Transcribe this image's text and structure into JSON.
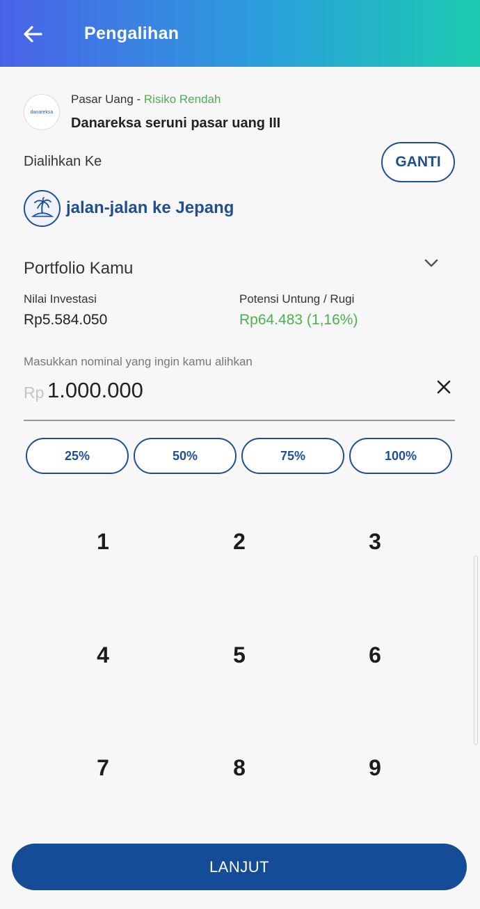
{
  "header": {
    "title": "Pengalihan",
    "back_icon": "arrow-left-icon"
  },
  "source_fund": {
    "logo_text": "danareksa",
    "category": "Pasar Uang",
    "separator": " - ",
    "risk": "Risiko Rendah",
    "risk_color": "#4caf50",
    "name": "Danareksa seruni pasar uang III"
  },
  "transfer_to": {
    "label": "Dialihkan Ke",
    "change_label": "GANTI"
  },
  "goal": {
    "icon": "palm-island-icon",
    "name": "jalan-jalan ke Jepang"
  },
  "portfolio": {
    "title": "Portfolio Kamu",
    "investment_label": "Nilai Investasi",
    "investment_value": "Rp5.584.050",
    "profit_label": "Potensi Untung / Rugi",
    "profit_value": "Rp64.483 (1,16%)",
    "profit_color": "#4caf50"
  },
  "amount": {
    "label": "Masukkan nominal yang ingin kamu alihkan",
    "currency": "Rp",
    "value": "1.000.000"
  },
  "percent_options": [
    "25%",
    "50%",
    "75%",
    "100%"
  ],
  "keypad": [
    "1",
    "2",
    "3",
    "4",
    "5",
    "6",
    "7",
    "8",
    "9"
  ],
  "footer": {
    "next_label": "LANJUT"
  },
  "colors": {
    "primary": "#1e4f94",
    "button": "#154c97",
    "success": "#4caf50"
  }
}
